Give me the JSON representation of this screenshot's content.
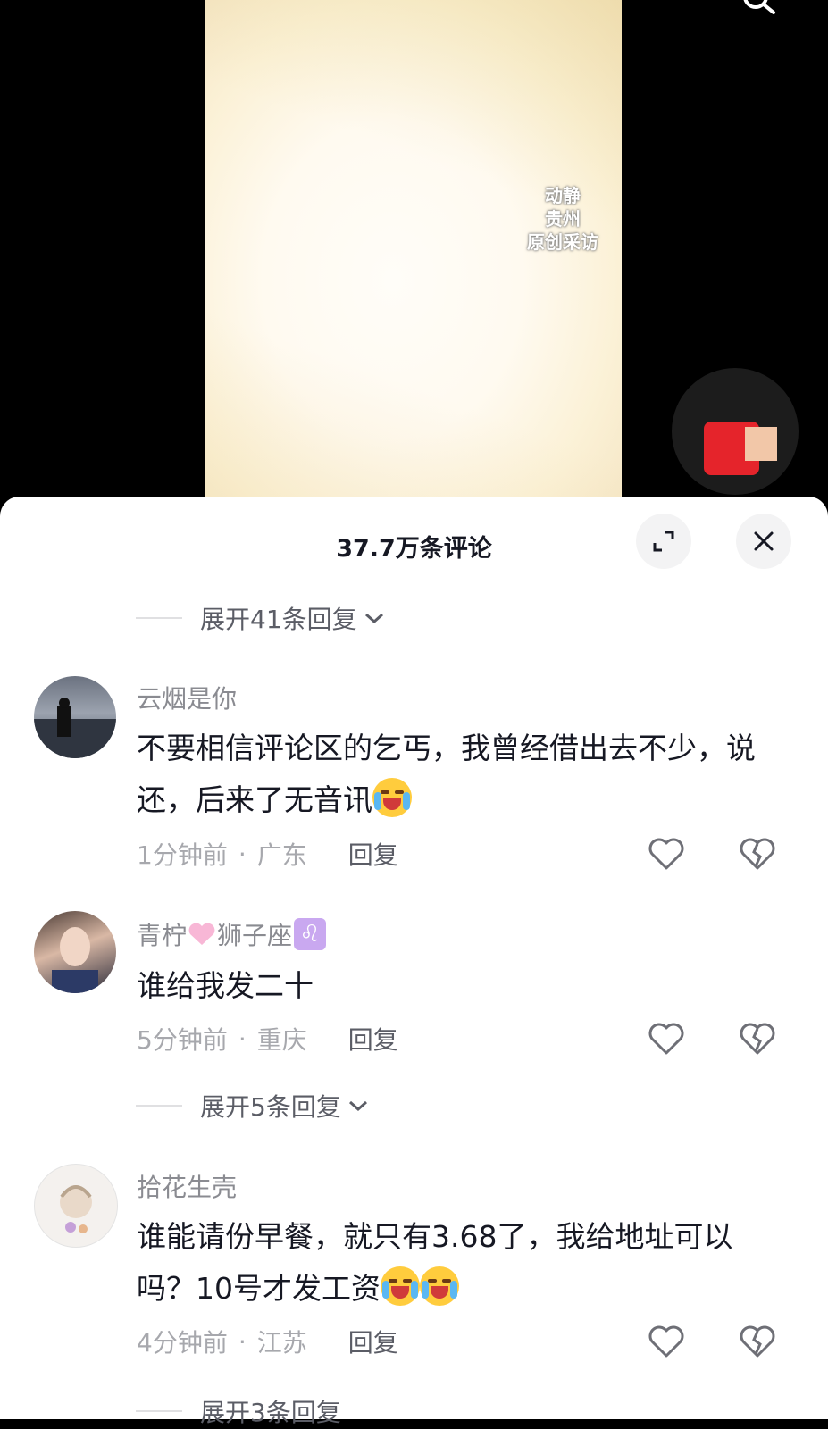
{
  "video": {
    "watermark_lines": [
      "动静",
      "贵州",
      "原创采访"
    ]
  },
  "comments_panel": {
    "title": "37.7万条评论",
    "top_expand": "展开41条回复",
    "mid_expand": "展开5条回复",
    "bottom_expand": "展开3条回复",
    "reply_label": "回复",
    "comments": [
      {
        "username": "云烟是你",
        "text": "不要相信评论区的乞丐，我曾经借出去不少，说还，后来了无音讯",
        "time": "1分钟前",
        "location": "广东"
      },
      {
        "username_part1": "青柠",
        "username_part2": "狮子座",
        "zodiac_symbol": "♌",
        "text": "谁给我发二十",
        "time": "5分钟前",
        "location": "重庆"
      },
      {
        "username": "拾花生壳",
        "text": "谁能请份早餐，就只有3.68了，我给地址可以吗？10号才发工资",
        "time": "4分钟前",
        "location": "江苏"
      }
    ]
  },
  "colors": {
    "text_primary": "#161823",
    "text_secondary": "#8a8b91",
    "sheet_bg": "#ffffff"
  }
}
